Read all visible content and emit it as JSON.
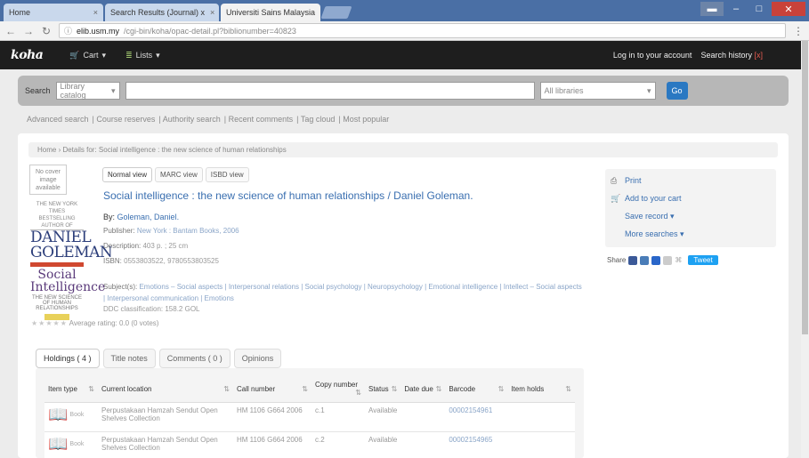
{
  "browser": {
    "tabs": [
      {
        "label": "Home"
      },
      {
        "label": "Search Results (Journal) x"
      },
      {
        "label": "Universiti Sains Malaysia"
      }
    ],
    "url_host": "elib.usm.my",
    "url_path": "/cgi-bin/koha/opac-detail.pl?biblionumber=40823"
  },
  "koha": {
    "logo": "koha",
    "nav_cart": "Cart",
    "nav_lists": "Lists",
    "login": "Log in to your account",
    "search_history": "Search history",
    "search_history_x": "[x]"
  },
  "search": {
    "label": "Search",
    "scope": "Library catalog",
    "library": "All libraries",
    "go": "Go"
  },
  "subnav": [
    "Advanced search",
    "Course reserves",
    "Authority search",
    "Recent comments",
    "Tag cloud",
    "Most popular"
  ],
  "breadcrumb": "Home › Details for: Social intelligence : the new science of human relationships",
  "record": {
    "no_image": "No cover image available",
    "view_tabs": [
      "Normal view",
      "MARC view",
      "ISBD view"
    ],
    "title": "Social intelligence : the new science of human relationships / Daniel Goleman.",
    "by_label": "By:",
    "author": "Goleman, Daniel.",
    "publisher_label": "Publisher:",
    "publisher": "New York : Bantam Books, 2006",
    "description_label": "Description:",
    "description": "403 p. ; 25 cm",
    "isbn_label": "ISBN:",
    "isbn": "0553803522, 9780553803525",
    "subjects_label": "Subject(s):",
    "subjects": "Emotions – Social aspects | Interpersonal relations | Social psychology | Neuropsychology | Emotional intelligence | Intellect – Social aspects | Interpersonal communication | Emotions",
    "ddc": "DDC classification: 158.2 GOL",
    "rating_text": "Average rating: 0.0 (0 votes)",
    "stars": "★★★★★",
    "cover": {
      "small": "THE NEW YORK TIMES BESTSELLING AUTHOR OF",
      "author": "DANIEL GOLEMAN",
      "title": "Social Intelligence",
      "sub": "THE NEW SCIENCE OF HUMAN RELATIONSHIPS"
    }
  },
  "sidebar": {
    "print": "Print",
    "cart": "Add to your cart",
    "save": "Save record",
    "more": "More searches",
    "share": "Share",
    "tweet": "Tweet"
  },
  "holdings": {
    "tabs": [
      "Holdings ( 4 )",
      "Title notes",
      "Comments ( 0 )",
      "Opinions"
    ],
    "columns": [
      "Item type",
      "Current location",
      "Call number",
      "Copy number",
      "Status",
      "Date due",
      "Barcode",
      "Item holds"
    ],
    "rows": [
      {
        "type": "Book",
        "location": "Perpustakaan Hamzah Sendut Open Shelves Collection",
        "call": "HM 1106 G664 2006",
        "copy": "c.1",
        "status": "Available",
        "due": "",
        "barcode": "00002154961",
        "holds": ""
      },
      {
        "type": "Book",
        "location": "Perpustakaan Hamzah Sendut Open Shelves Collection",
        "call": "HM 1106 G664 2006",
        "copy": "c.2",
        "status": "Available",
        "due": "",
        "barcode": "00002154965",
        "holds": ""
      }
    ]
  }
}
